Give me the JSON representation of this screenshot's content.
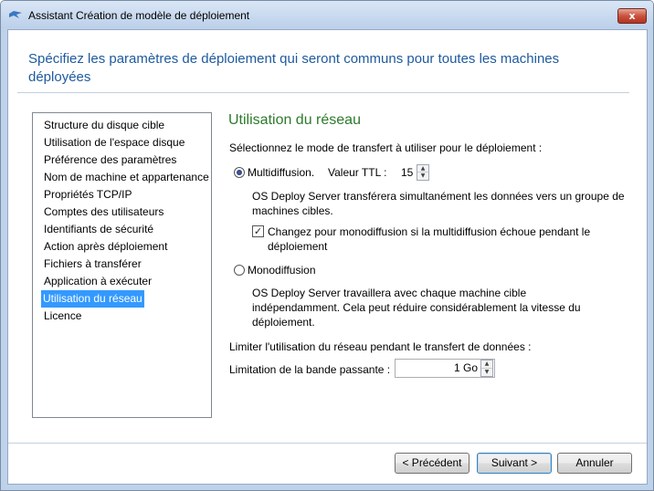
{
  "window": {
    "title": "Assistant Création de modèle de déploiement",
    "close_label": "x"
  },
  "header": {
    "text": "Spécifiez les paramètres de déploiement qui seront communs pour toutes les machines déployées"
  },
  "nav": {
    "items": [
      {
        "label": "Structure du disque cible"
      },
      {
        "label": "Utilisation de l'espace disque"
      },
      {
        "label": "Préférence des paramètres"
      },
      {
        "label": "Nom de machine et appartenance"
      },
      {
        "label": "Propriétés TCP/IP"
      },
      {
        "label": "Comptes des utilisateurs"
      },
      {
        "label": "Identifiants de sécurité"
      },
      {
        "label": "Action après déploiement"
      },
      {
        "label": "Fichiers à transférer"
      },
      {
        "label": "Application à exécuter"
      },
      {
        "label": "Utilisation du réseau",
        "selected": true
      },
      {
        "label": "Licence"
      }
    ]
  },
  "section": {
    "title": "Utilisation du réseau",
    "prompt": "Sélectionnez le mode de transfert à utiliser pour le déploiement :",
    "multicast_label": "Multidiffusion.",
    "ttl_label": "Valeur TTL :",
    "ttl_value": "15",
    "multicast_desc": "OS Deploy Server transférera simultanément les données vers un groupe de machines cibles.",
    "fallback_label": "Changez pour monodiffusion si la multidiffusion échoue pendant le déploiement",
    "fallback_checked": true,
    "unicast_label": "Monodiffusion",
    "unicast_desc": "OS Deploy Server travaillera avec chaque machine cible indépendamment. Cela peut réduire considérablement la vitesse du déploiement.",
    "limit_prompt": "Limiter l'utilisation du réseau pendant le transfert de données :",
    "bandwidth_label": "Limitation de la bande passante :",
    "bandwidth_value": "1 Go",
    "selected_mode": "multicast"
  },
  "buttons": {
    "back": "< Précédent",
    "next": "Suivant >",
    "cancel": "Annuler"
  }
}
